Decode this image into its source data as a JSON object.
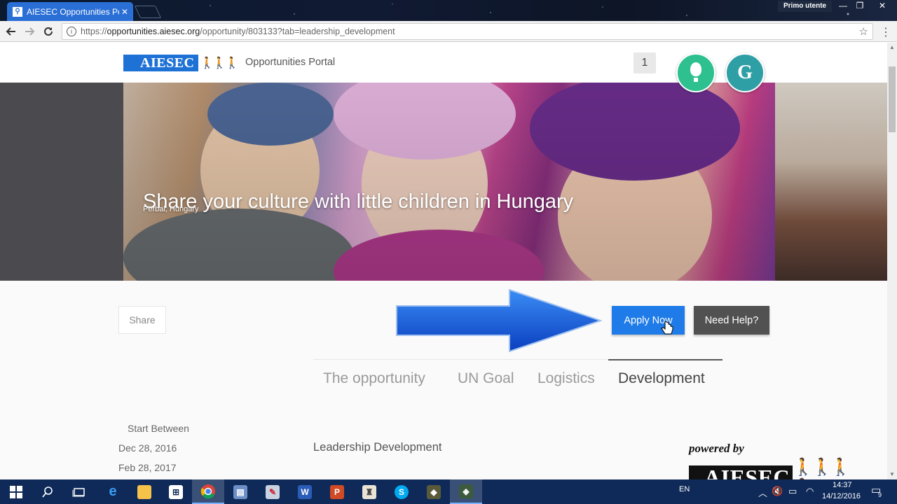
{
  "browser": {
    "tab_title": "AIESEC Opportunities Po",
    "tab_close": "✕",
    "user_badge": "Primo utente",
    "url_scheme": "https://",
    "url_host": "opportunities.aiesec.org",
    "url_path": "/opportunity/803133?tab=leadership_development",
    "window_controls": [
      "—",
      "❐",
      "✕"
    ]
  },
  "header": {
    "logo_text": "AIESEC",
    "portal_title": "Opportunities Portal",
    "notification_count": "1",
    "avatar_letter": "G",
    "colors": {
      "brand_blue": "#1e72d6",
      "avatar_green": "#2ec08f",
      "avatar_teal": "#2f9fa6"
    }
  },
  "hero": {
    "title": "Share your culture with little children in Hungary",
    "location": "Perbal, Hungary"
  },
  "actions": {
    "share_label": "Share",
    "apply_label": "Apply Now",
    "help_label": "Need Help?",
    "colors": {
      "apply_blue": "#1e7be8",
      "help_gray": "#515151"
    }
  },
  "tabs": {
    "items": [
      "The opportunity",
      "UN Goal",
      "Logistics",
      "Development"
    ],
    "active": "Development"
  },
  "details": {
    "start_label": "Start Between",
    "start_date": "Dec 28, 2016",
    "end_date": "Feb 28, 2017",
    "section_heading": "Leadership Development"
  },
  "watermark": {
    "powered_by": "powered by",
    "brand": "AIESEC"
  },
  "taskbar": {
    "language": "EN",
    "time": "14:37",
    "date": "14/12/2016",
    "notification_count": "9",
    "apps": [
      "start-icon",
      "search-icon",
      "task-view-icon",
      "edge-icon",
      "file-explorer-icon",
      "store-icon",
      "chrome-icon",
      "app-icon",
      "app-icon",
      "word-icon",
      "powerpoint-icon",
      "app-icon",
      "skype-icon",
      "app-icon",
      "app-icon"
    ]
  }
}
